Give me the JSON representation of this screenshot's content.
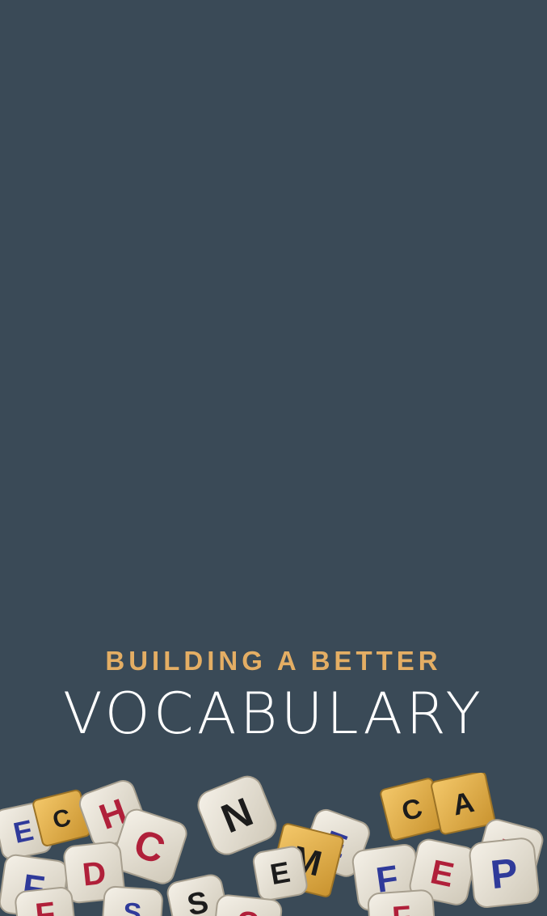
{
  "splash": {
    "subtitle": "BUILDING A BETTER",
    "title": "VOCABULARY"
  },
  "colors": {
    "background": "#3a4a57",
    "subtitle": "#e4ae64",
    "title": "#ffffff"
  },
  "illustration": {
    "icon": "letter-dice-pile",
    "letters": [
      "C",
      "H",
      "C",
      "N",
      "M",
      "E",
      "C",
      "A",
      "T",
      "F",
      "P",
      "F",
      "S",
      "E",
      "S",
      "F",
      "C"
    ]
  }
}
